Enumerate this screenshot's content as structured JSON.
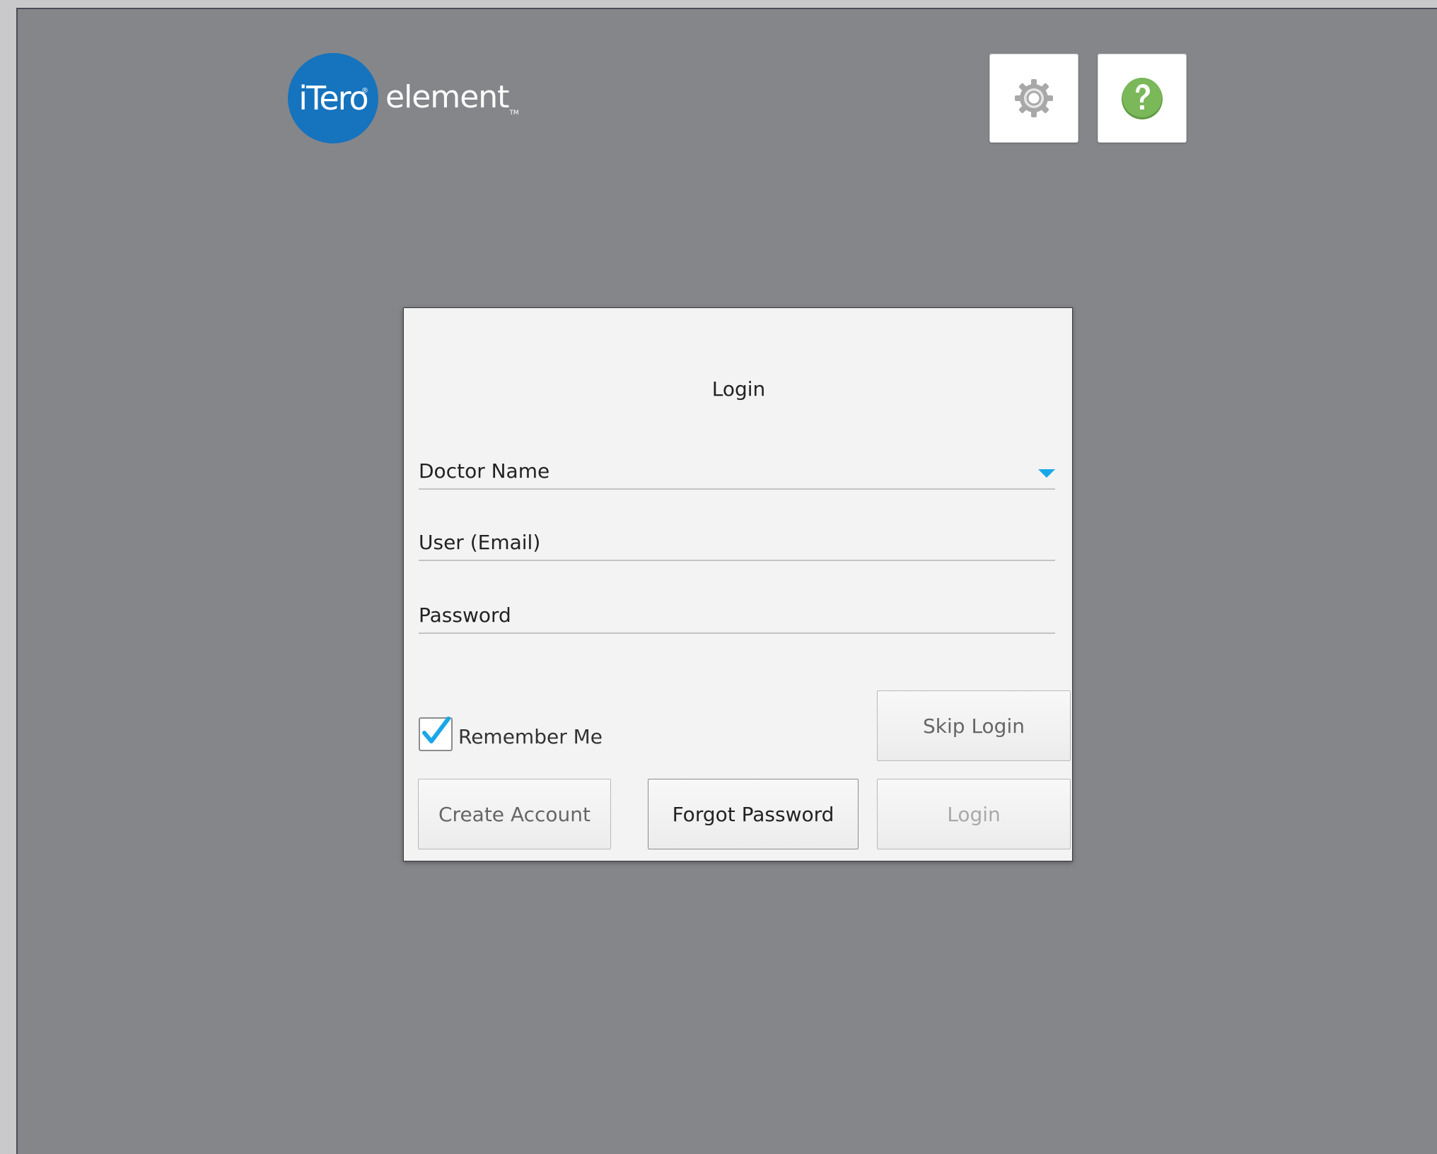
{
  "header": {
    "logo_badge": "iTero",
    "logo_reg": "®",
    "logo_word": "element",
    "logo_tm": "TM",
    "settings_icon": "gear-icon",
    "help_icon": "question-icon"
  },
  "login": {
    "title": "Login",
    "doctor_name_label": "Doctor Name",
    "user_label": "User (Email)",
    "password_label": "Password",
    "remember_label": "Remember Me",
    "remember_checked": true,
    "skip_login_label": "Skip Login",
    "create_account_label": "Create Account",
    "forgot_password_label": "Forgot Password",
    "login_label": "Login"
  },
  "colors": {
    "brand_blue": "#1673bd",
    "accent_blue": "#1aa7e8",
    "help_green": "#7ab85a",
    "background": "#85868a"
  }
}
